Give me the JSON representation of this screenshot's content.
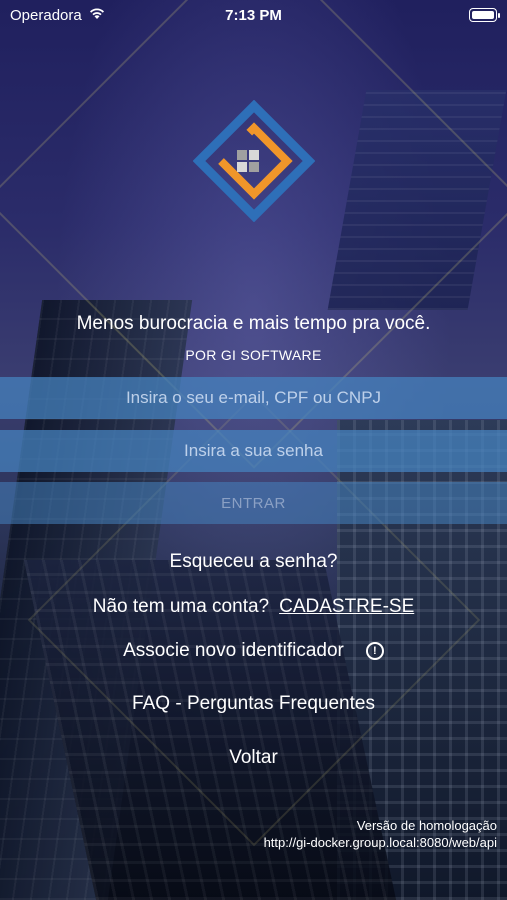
{
  "status_bar": {
    "carrier": "Operadora",
    "time": "7:13 PM",
    "wifi_icon": "wifi-icon",
    "battery_icon": "battery-icon"
  },
  "branding": {
    "logo_icon": "house-logo-icon",
    "tagline": "Menos burocracia e mais tempo pra você.",
    "byline": "POR GI SOFTWARE",
    "colors": {
      "blue": "#2e6fb8",
      "orange": "#f0962a",
      "gray": "#9a9a9a"
    }
  },
  "login_form": {
    "email_placeholder": "Insira o seu e-mail, CPF ou CNPJ",
    "email_value": "",
    "password_placeholder": "Insira a sua senha",
    "password_value": "",
    "enter_label": "ENTRAR"
  },
  "links": {
    "forgot_password": "Esqueceu a senha?",
    "no_account": "Não tem uma conta?",
    "signup": "CADASTRE-SE",
    "associate": "Associe novo identificador",
    "associate_info_icon": "info-circle-icon",
    "faq": "FAQ - Perguntas Frequentes",
    "back": "Voltar"
  },
  "version": {
    "label": "Versão de homologação",
    "url": "http://gi-docker.group.local:8080/web/api"
  }
}
